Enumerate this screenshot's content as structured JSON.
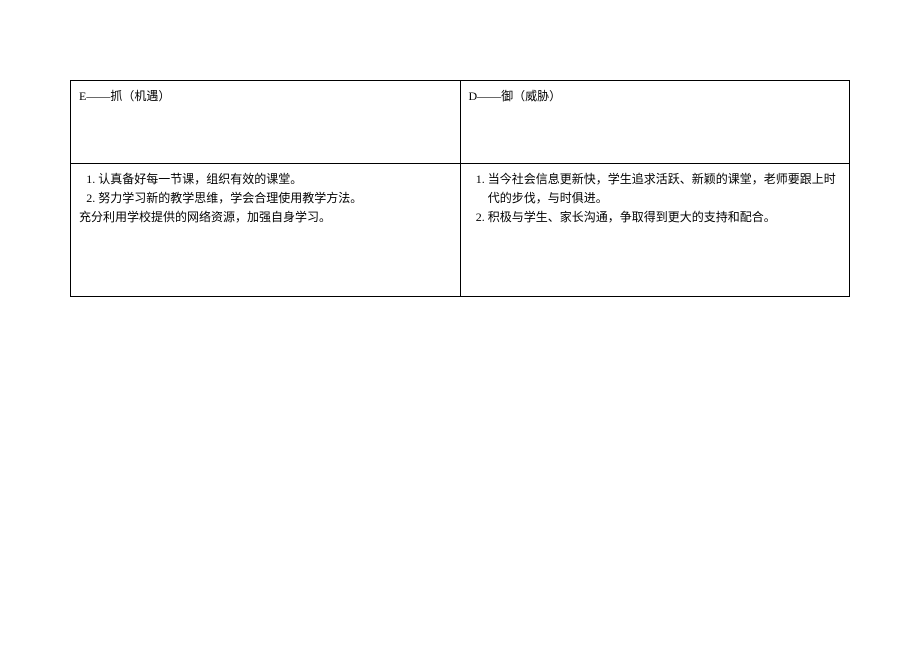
{
  "header": {
    "left": "E——抓（机遇）",
    "right": "D——御（威胁）"
  },
  "left_items": [
    "认真备好每一节课，组织有效的课堂。",
    "努力学习新的教学思维，学会合理使用教学方法。"
  ],
  "left_extra": "充分利用学校提供的网络资源，加强自身学习。",
  "right_items": [
    "当今社会信息更新快，学生追求活跃、新颖的课堂，老师要跟上时代的步伐，与时俱进。",
    "积极与学生、家长沟通，争取得到更大的支持和配合。"
  ]
}
